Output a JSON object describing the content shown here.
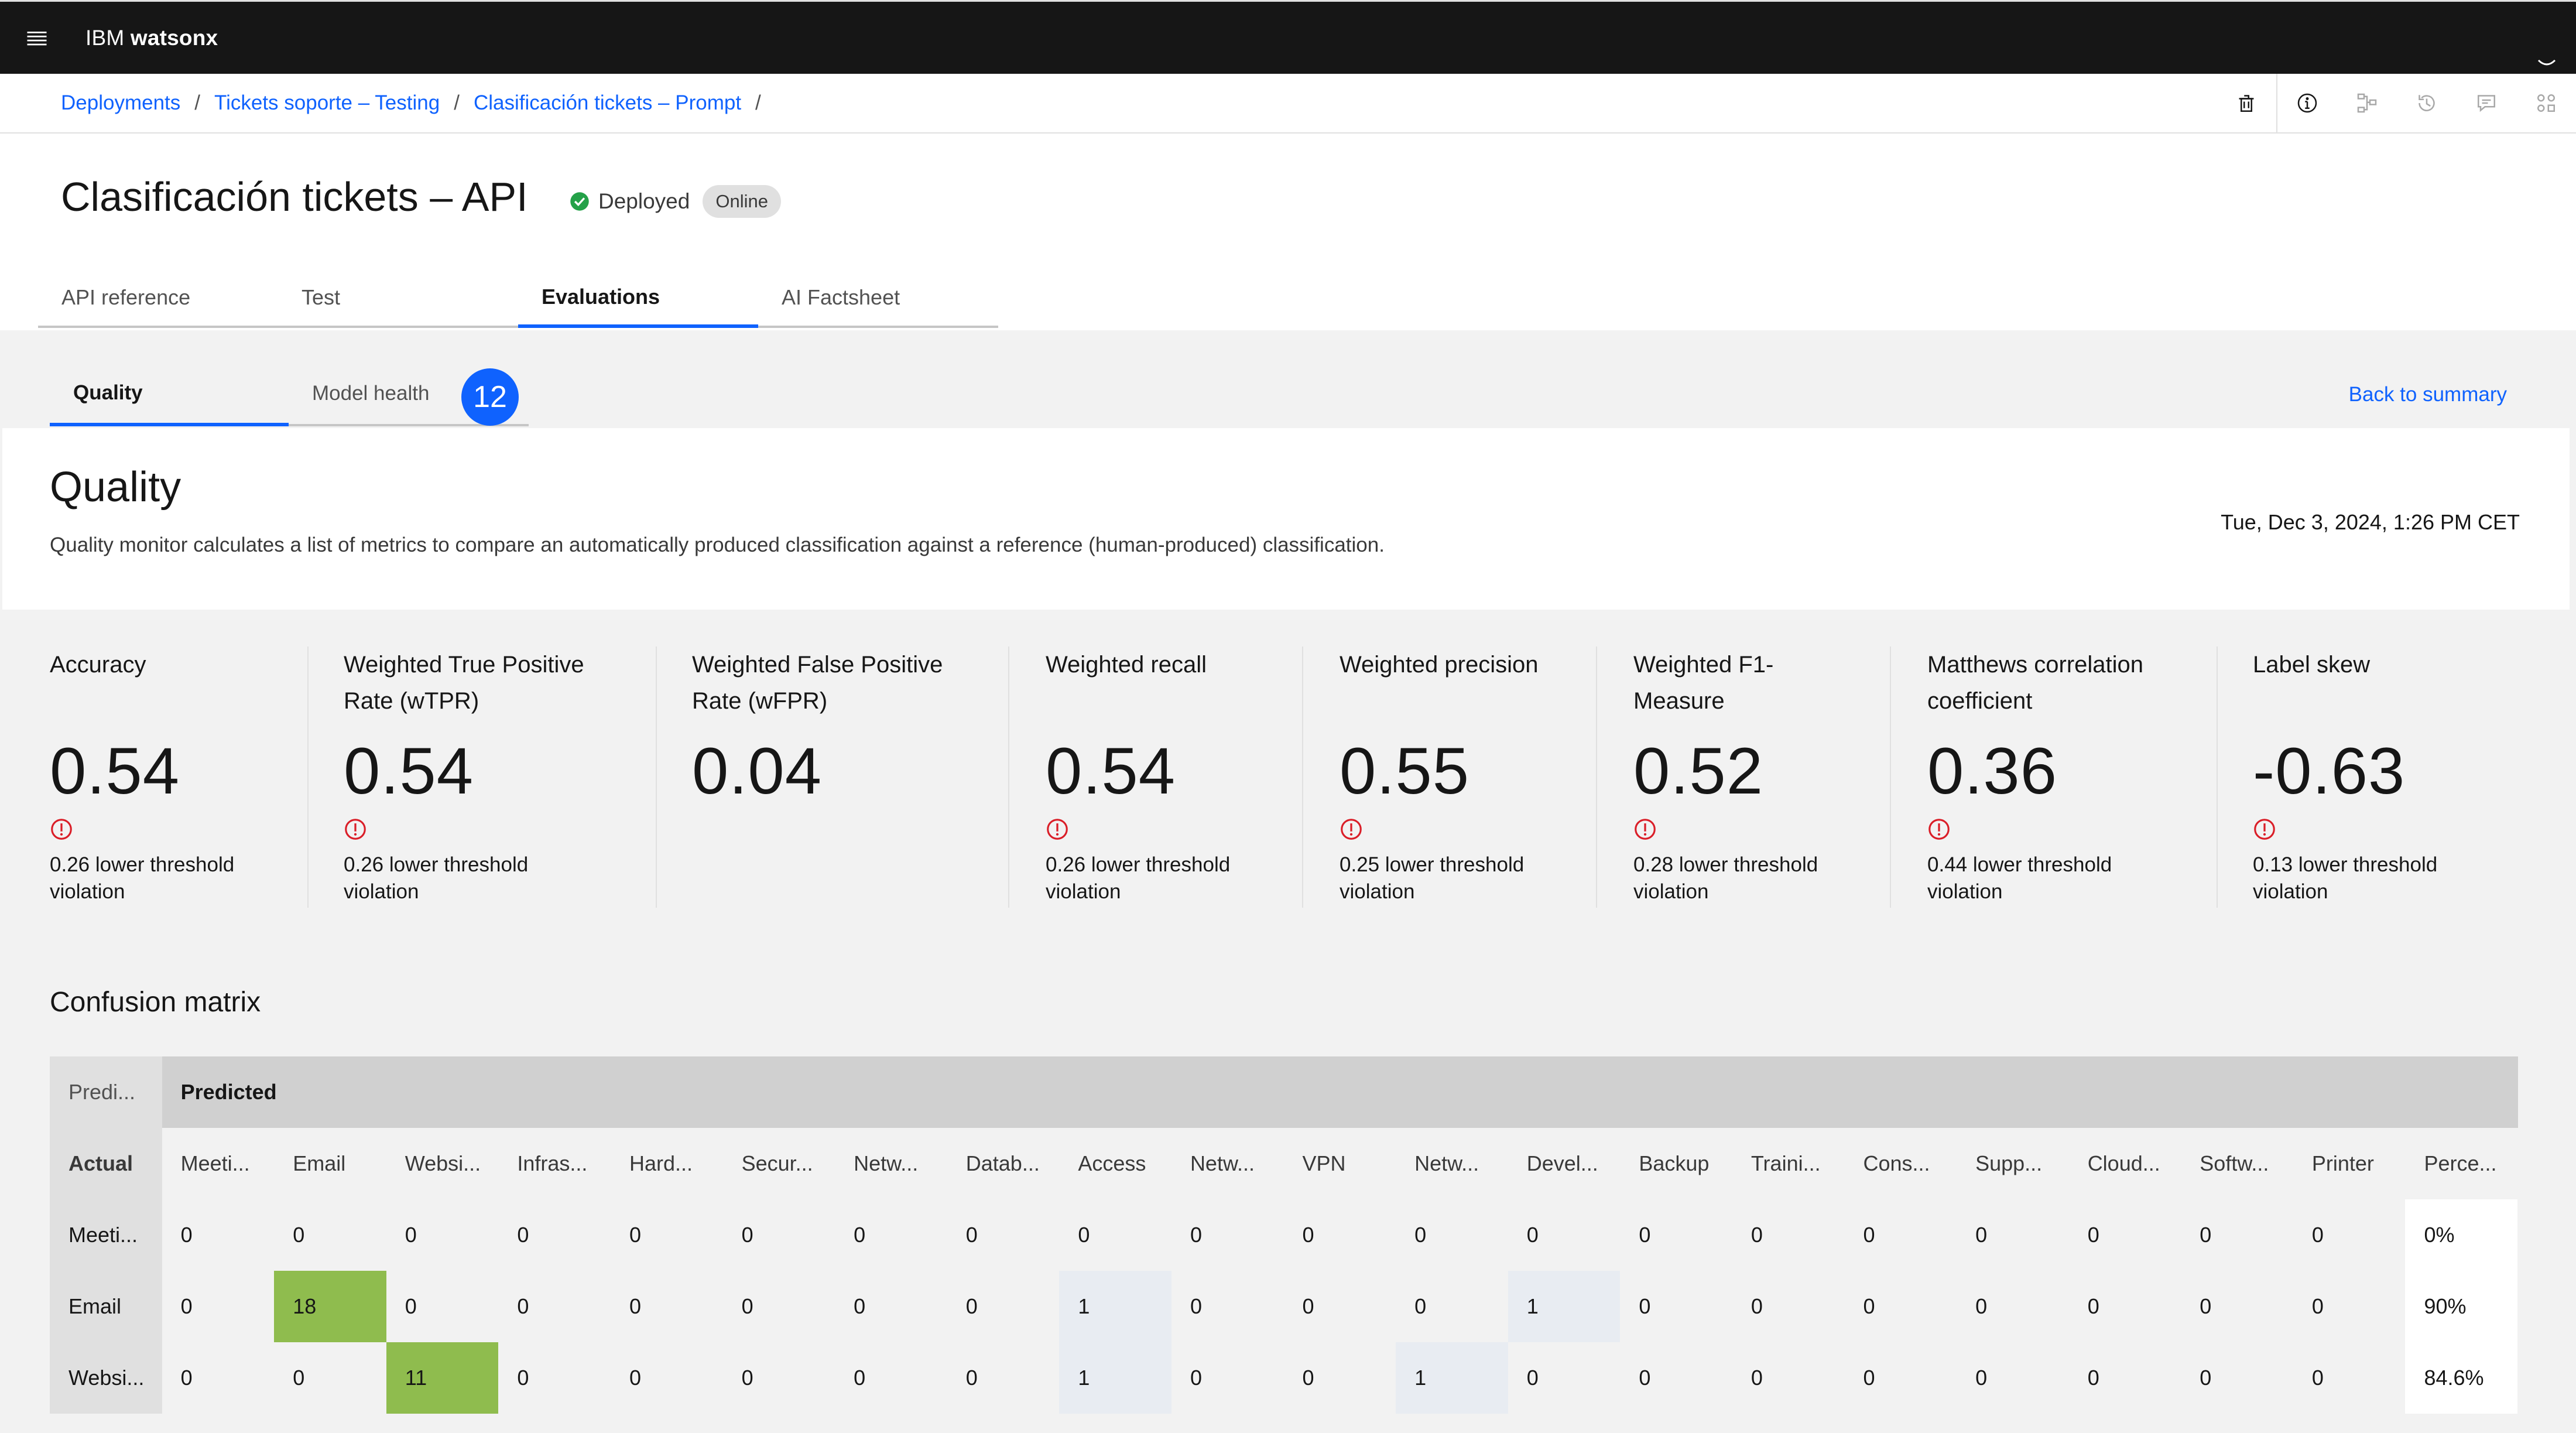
{
  "header": {
    "brand_prefix": "IBM",
    "brand_name": "watsonx"
  },
  "breadcrumb": [
    "Deployments",
    "Tickets soporte – Testing",
    "Clasificación tickets – Prompt"
  ],
  "breadcrumb_sep": "/",
  "toolbar": [
    "trash-icon",
    "info-icon",
    "lineage-icon",
    "history-icon",
    "comment-icon",
    "apps-icon"
  ],
  "page": {
    "title": "Clasificación tickets – API",
    "status": "Deployed",
    "badge": "Online"
  },
  "tabs": [
    "API reference",
    "Test",
    "Evaluations",
    "AI Factsheet"
  ],
  "active_tab": "Evaluations",
  "subtabs": [
    "Quality",
    "Model health"
  ],
  "active_subtab": "Quality",
  "step_badge": "12",
  "back_link": "Back to summary",
  "quality": {
    "title": "Quality",
    "description": "Quality monitor calculates a list of metrics to compare an automatically produced classification against a reference (human-produced) classification.",
    "date": "Tue, Dec 3, 2024, 1:26 PM CET"
  },
  "metrics": [
    {
      "label1": "Accuracy",
      "label2": "",
      "value": "0.54",
      "warning": true,
      "note1": "0.26 lower threshold",
      "note2": "violation"
    },
    {
      "label1": "Weighted True Positive",
      "label2": "Rate (wTPR)",
      "value": "0.54",
      "warning": true,
      "note1": "0.26 lower threshold",
      "note2": "violation"
    },
    {
      "label1": "Weighted False Positive",
      "label2": "Rate (wFPR)",
      "value": "0.04",
      "warning": false,
      "note1": "",
      "note2": ""
    },
    {
      "label1": "Weighted recall",
      "label2": "",
      "value": "0.54",
      "warning": true,
      "note1": "0.26 lower threshold",
      "note2": "violation"
    },
    {
      "label1": "Weighted precision",
      "label2": "",
      "value": "0.55",
      "warning": true,
      "note1": "0.25 lower threshold",
      "note2": "violation"
    },
    {
      "label1": "Weighted F1-",
      "label2": "Measure",
      "value": "0.52",
      "warning": true,
      "note1": "0.28 lower threshold",
      "note2": "violation"
    },
    {
      "label1": "Matthews correlation",
      "label2": "coefficient",
      "value": "0.36",
      "warning": true,
      "note1": "0.44 lower threshold",
      "note2": "violation"
    },
    {
      "label1": "Label skew",
      "label2": "",
      "value": "-0.63",
      "warning": true,
      "note1": "0.13 lower threshold",
      "note2": "violation"
    }
  ],
  "confusion": {
    "title": "Confusion matrix",
    "corner": "Predi...",
    "predicted_header": "Predicted",
    "actual_header": "Actual",
    "columns": [
      "Meeti...",
      "Email",
      "Websi...",
      "Infras...",
      "Hard...",
      "Secur...",
      "Netw...",
      "Datab...",
      "Access",
      "Netw...",
      "VPN",
      "Netw...",
      "Devel...",
      "Backup",
      "Traini...",
      "Cons...",
      "Supp...",
      "Cloud...",
      "Softw...",
      "Printer",
      "Perce..."
    ],
    "rows": [
      {
        "label": "Meeti...",
        "values": [
          "0",
          "0",
          "0",
          "0",
          "0",
          "0",
          "0",
          "0",
          "0",
          "0",
          "0",
          "0",
          "0",
          "0",
          "0",
          "0",
          "0",
          "0",
          "0",
          "0"
        ],
        "percent": "0%"
      },
      {
        "label": "Email",
        "values": [
          "0",
          "18",
          "0",
          "0",
          "0",
          "0",
          "0",
          "0",
          "1",
          "0",
          "0",
          "0",
          "1",
          "0",
          "0",
          "0",
          "0",
          "0",
          "0",
          "0"
        ],
        "percent": "90%"
      },
      {
        "label": "Websi...",
        "values": [
          "0",
          "0",
          "11",
          "0",
          "0",
          "0",
          "0",
          "0",
          "1",
          "0",
          "0",
          "1",
          "0",
          "0",
          "0",
          "0",
          "0",
          "0",
          "0",
          "0"
        ],
        "percent": "84.6%"
      }
    ],
    "colors": {
      "diagonal": "#8fbc4e",
      "off_diagonal": "#e8ecf2"
    }
  }
}
